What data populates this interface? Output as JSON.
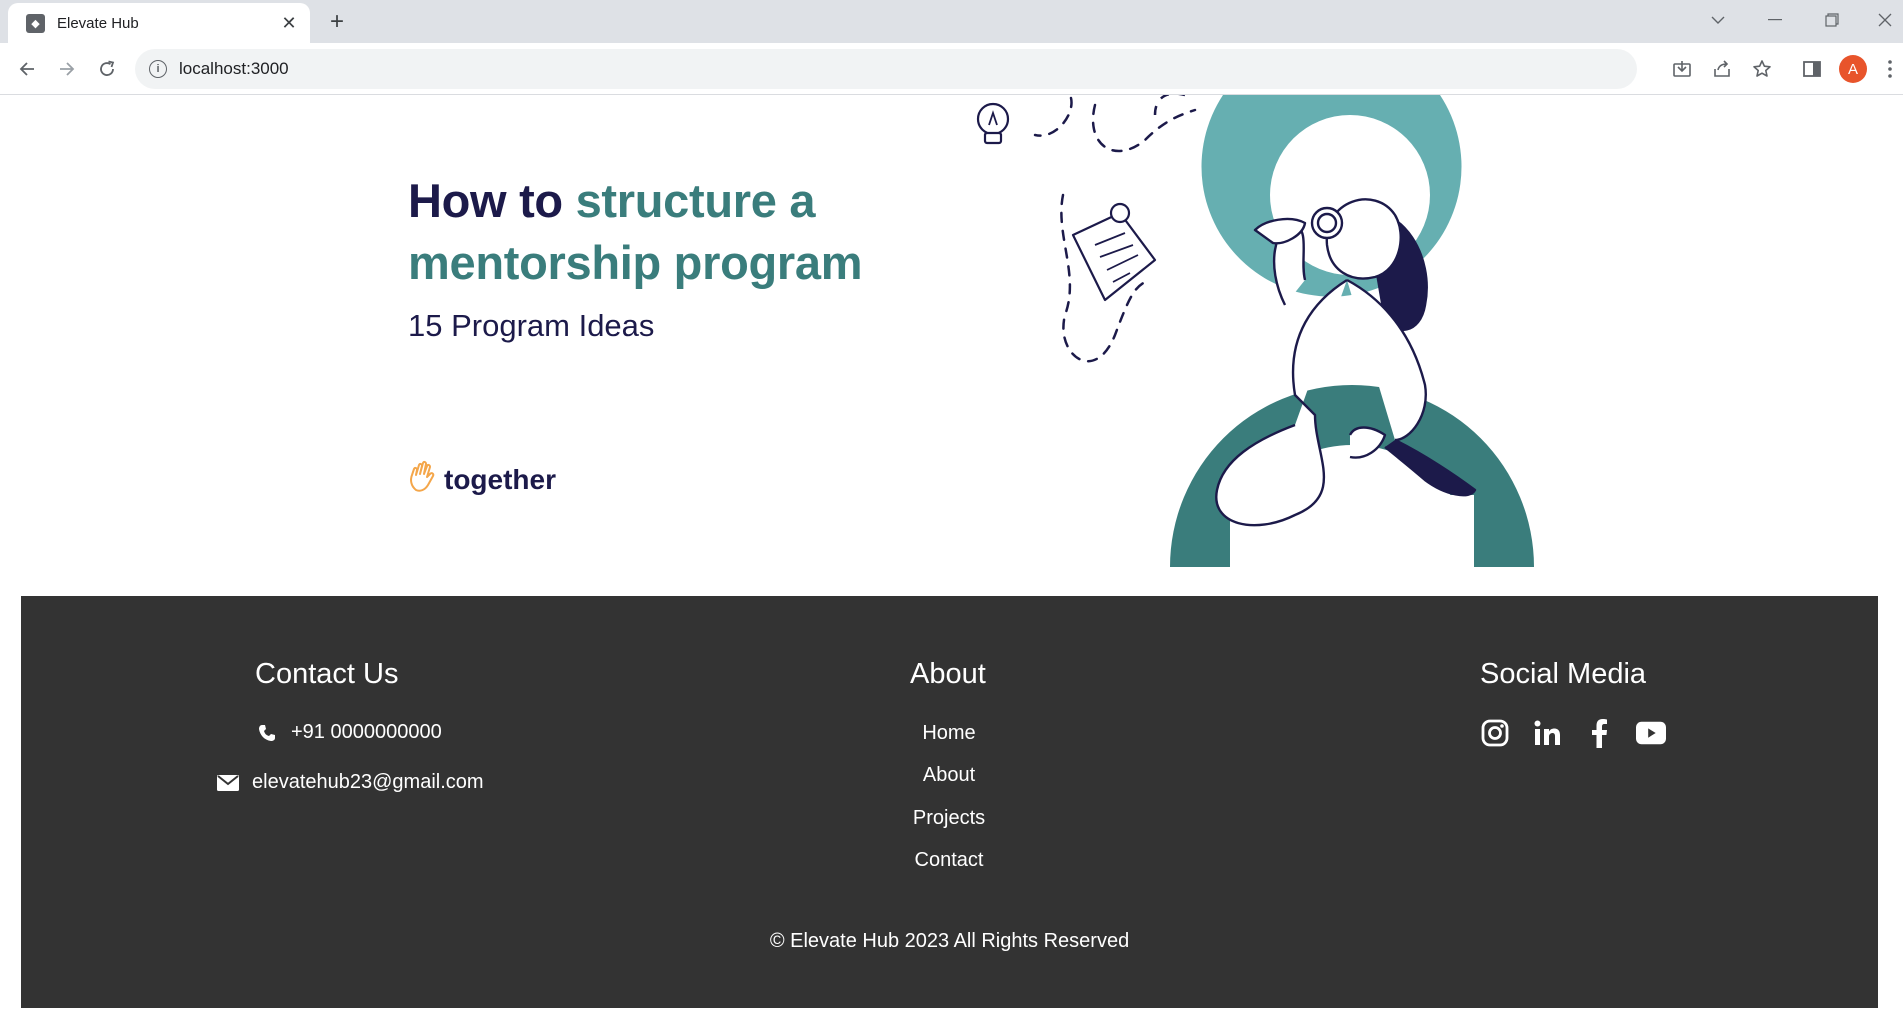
{
  "browser": {
    "tab_title": "Elevate Hub",
    "url": "localhost:3000",
    "avatar_letter": "A",
    "new_tab_symbol": "+",
    "close_symbol": "✕"
  },
  "hero": {
    "title_part1": "How to ",
    "title_part2": "structure a mentorship program",
    "subtitle": "15 Program Ideas",
    "brand": "together"
  },
  "footer": {
    "contact": {
      "heading": "Contact Us",
      "phone": "+91 0000000000",
      "email": "elevatehub23@gmail.com"
    },
    "about": {
      "heading": "About",
      "links": [
        "Home",
        "About",
        "Projects",
        "Contact"
      ]
    },
    "social": {
      "heading": "Social Media",
      "icons": [
        "instagram-icon",
        "linkedin-icon",
        "facebook-icon",
        "youtube-icon"
      ]
    },
    "copyright": "© Elevate Hub 2023 All Rights Reserved"
  },
  "colors": {
    "navy": "#1c1a4a",
    "teal": "#3a7d7c",
    "teal_light": "#66afb1",
    "footer_bg": "#333333",
    "brand_orange": "#f4a64a"
  }
}
